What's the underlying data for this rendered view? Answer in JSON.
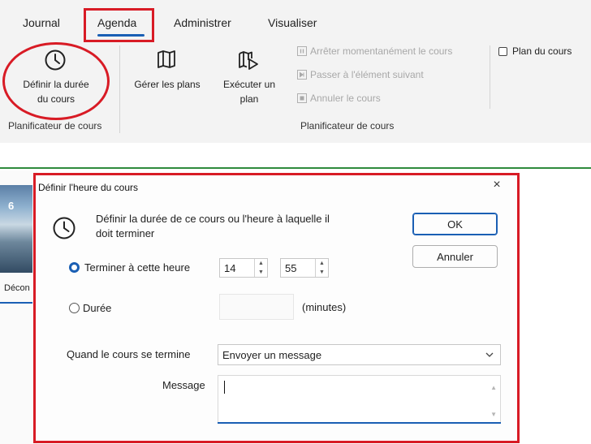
{
  "ribbon": {
    "tabs": [
      {
        "label": "Journal"
      },
      {
        "label": "Agenda"
      },
      {
        "label": "Administrer"
      },
      {
        "label": "Visualiser"
      }
    ],
    "active_tab": "Agenda",
    "buttons": {
      "set_duration": {
        "line1": "Définir la durée",
        "line2": "du cours"
      },
      "manage_plans": {
        "line1": "Gérer les plans"
      },
      "run_plan": {
        "line1": "Exécuter un",
        "line2": "plan"
      }
    },
    "small_items": [
      {
        "label": "Arrêter momentanément le cours"
      },
      {
        "label": "Passer à l'élément suivant"
      },
      {
        "label": "Annuler le cours"
      }
    ],
    "checkbox_plan": {
      "label": "Plan du cours",
      "checked": false
    },
    "group_labels": {
      "left": "Planificateur de cours",
      "right": "Planificateur de cours"
    },
    "accent_color": "#1a5fb4",
    "highlight_color": "#d81b25"
  },
  "background": {
    "thumb_number": "6",
    "thumb_caption": "Décon"
  },
  "dialog": {
    "title": "Définir l'heure du cours",
    "close": "×",
    "description_line1": "Définir la durée de ce cours ou l'heure à laquelle il",
    "description_line2": "doit terminer",
    "ok_label": "OK",
    "cancel_label": "Annuler",
    "end_time": {
      "label": "Terminer à cette heure",
      "selected": true,
      "hour": "14",
      "minute": "55"
    },
    "duration": {
      "label": "Durée",
      "selected": false,
      "value": "",
      "unit": "(minutes)"
    },
    "when_ends": {
      "label": "Quand le cours se termine",
      "selected_option": "Envoyer un message"
    },
    "message": {
      "label": "Message",
      "value": ""
    }
  }
}
